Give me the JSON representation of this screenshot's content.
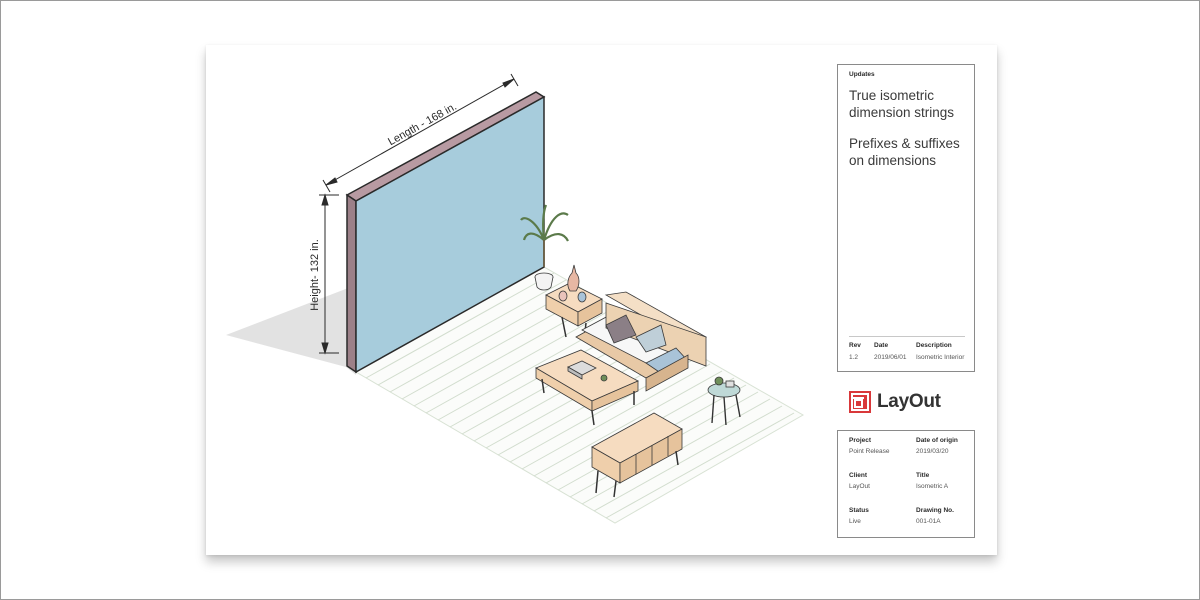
{
  "drawing": {
    "length_label": "Length - 168 in.",
    "height_label": "Height- 132 in."
  },
  "updates": {
    "heading": "Updates",
    "items": [
      "True isometric dimension strings",
      "Prefixes & suffixes on dimensions"
    ],
    "revision_table": {
      "headers": [
        "Rev",
        "Date",
        "Description"
      ],
      "row": [
        "1.2",
        "2019/06/01",
        "Isometric Interior"
      ]
    }
  },
  "logo": {
    "text": "LayOut",
    "icon": "layout-logo-icon",
    "color": "#d9383a"
  },
  "titleblock": {
    "project_label": "Project",
    "project_value": "Point Release",
    "origin_label": "Date of origin",
    "origin_value": "2019/03/20",
    "client_label": "Client",
    "client_value": "LayOut",
    "title_label": "Title",
    "title_value": "Isometric A",
    "status_label": "Status",
    "status_value": "Live",
    "drawing_label": "Drawing No.",
    "drawing_value": "001-01A"
  },
  "colors": {
    "wall_face": "#a7ccdc",
    "wall_edge": "#9c8088",
    "floor_line": "#cdd9c8",
    "wood": "#f1d3b3",
    "sofa_pillow_dark": "#8b7f86",
    "sofa_pillow_light": "#bfcfd8",
    "blanket": "#a9c3d8"
  }
}
